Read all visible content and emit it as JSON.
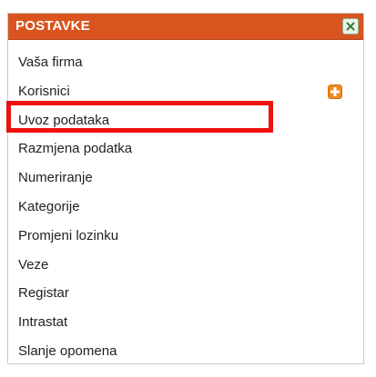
{
  "panel": {
    "title": "POSTAVKE",
    "close_icon": "close-icon",
    "header_color": "#d9541e"
  },
  "menu": {
    "items": [
      {
        "label": "Vaša firma"
      },
      {
        "label": "Korisnici",
        "action_icon": "add-icon"
      },
      {
        "label": "Uvoz podataka",
        "highlighted": true
      },
      {
        "label": "Razmjena podatka"
      },
      {
        "label": "Numeriranje"
      },
      {
        "label": "Kategorije"
      },
      {
        "label": "Promjeni lozinku"
      },
      {
        "label": "Veze"
      },
      {
        "label": "Registar"
      },
      {
        "label": "Intrastat"
      },
      {
        "label": "Slanje opomena"
      }
    ]
  },
  "annotation": {
    "highlight_color": "#ee1111"
  }
}
